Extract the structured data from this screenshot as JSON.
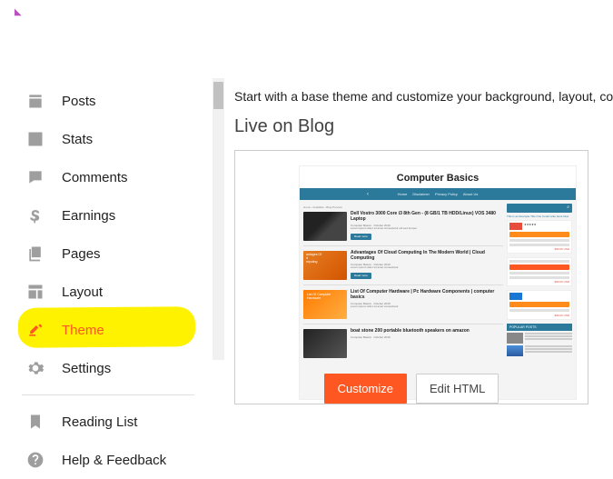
{
  "sidebar": {
    "items": [
      {
        "label": "Posts"
      },
      {
        "label": "Stats"
      },
      {
        "label": "Comments"
      },
      {
        "label": "Earnings"
      },
      {
        "label": "Pages"
      },
      {
        "label": "Layout"
      },
      {
        "label": "Theme"
      },
      {
        "label": "Settings"
      }
    ],
    "footer": [
      {
        "label": "Reading List"
      },
      {
        "label": "Help & Feedback"
      }
    ]
  },
  "main": {
    "intro": "Start with a base theme and customize your background, layout, colors",
    "section_title": "Live on Blog",
    "preview": {
      "blog_title": "Computer Basics",
      "nav": [
        "Home",
        "Disclaimer",
        "Privacy Policy",
        "About Us"
      ],
      "posts": [
        {
          "title": "Dell Vostro 3000 Core i3 8th Gen - (8 GB/1 TB HDD/Linux) VOS 3480 Laptop"
        },
        {
          "title": "Advantages Of Cloud Computing In The Modern World | Cloud Computing"
        },
        {
          "title": "List Of Computer Hardware | Pc Hardware Components | computer basics"
        },
        {
          "title": "boat stone 200 portable bluetooth speakers on amazon"
        }
      ],
      "popular_header": "POPULAR POSTS"
    },
    "buttons": {
      "customize": "Customize",
      "edit_html": "Edit HTML"
    }
  }
}
